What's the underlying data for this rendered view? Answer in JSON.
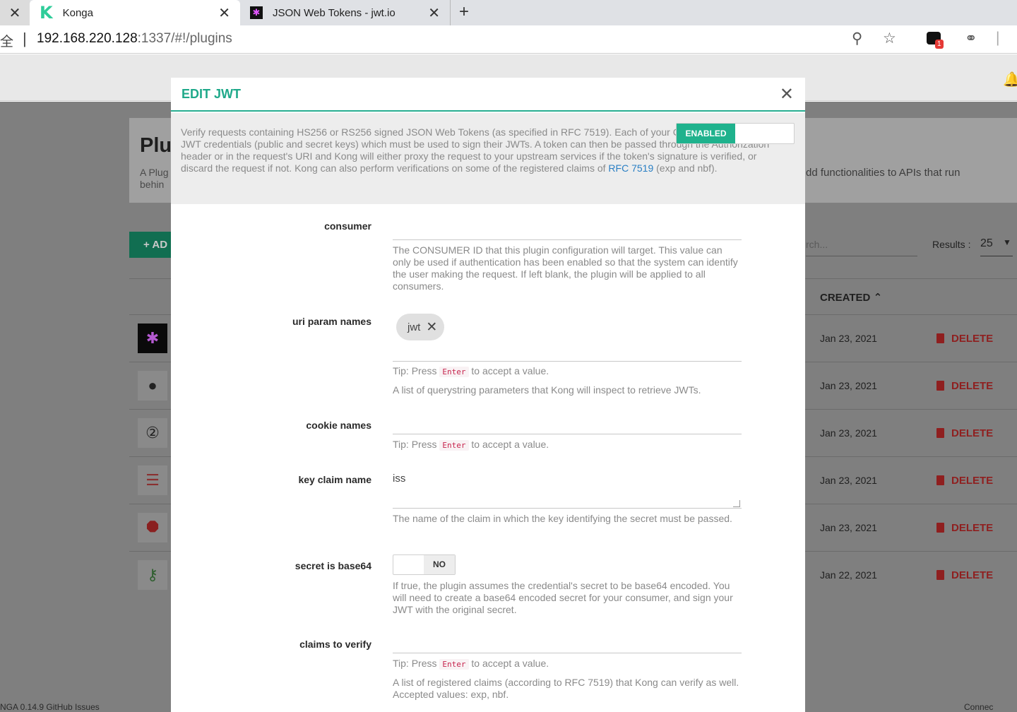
{
  "browser": {
    "tabs": [
      {
        "title": "Konga",
        "favicon": "konga-logo-icon"
      },
      {
        "title": "JSON Web Tokens - jwt.io",
        "favicon": "jwt-icon"
      }
    ],
    "close_glyph": "✕",
    "new_tab_glyph": "+",
    "address_lead": "全",
    "url_host": "192.168.220.128",
    "url_path": ":1337/#!/plugins",
    "extension_badge": "1"
  },
  "background_page": {
    "section_title": "Plu",
    "section_desc_lines": [
      "A Plug",
      "behin"
    ],
    "section_desc_right": "dd functionalities to APIs that run",
    "add_button": "+ AD",
    "search_placeholder": "rch...",
    "results_label": "Results :",
    "results_value": "25",
    "created_header": "CREATED",
    "delete_label": "DELETE",
    "rows": [
      {
        "date": "Jan 23, 2021",
        "icon": "jwt-plugin-icon"
      },
      {
        "date": "Jan 23, 2021",
        "icon": "dots-plugin-icon"
      },
      {
        "date": "Jan 23, 2021",
        "icon": "oauth2-plugin-icon"
      },
      {
        "date": "Jan 23, 2021",
        "icon": "server-plugin-icon"
      },
      {
        "date": "Jan 23, 2021",
        "icon": "stop-plugin-icon"
      },
      {
        "date": "Jan 22, 2021",
        "icon": "key-plugin-icon"
      }
    ],
    "footer_left": "NGA 0.14.9    GitHub    Issues",
    "footer_right": "Connec"
  },
  "modal": {
    "title": "EDIT JWT",
    "close_glyph": "✕",
    "description": "Verify requests containing HS256 or RS256 signed JSON Web Tokens (as specified in RFC 7519). Each of your Consumers will have JWT credentials (public and secret keys) which must be used to sign their JWTs. A token can then be passed through the Authorization header or in the request's URI and Kong will either proxy the request to your upstream services if the token's signature is verified, or discard the request if not. Kong can also perform verifications on some of the registered claims of",
    "description_link": "RFC 7519",
    "description_tail": "(exp and nbf).",
    "enabled_label": "ENABLED",
    "tip_prefix": "Tip: Press",
    "tip_key": "Enter",
    "tip_suffix": "to accept a value.",
    "fields": {
      "consumer": {
        "label": "consumer",
        "value": "",
        "help": "The CONSUMER ID that this plugin configuration will target. This value can only be used if authentication has been enabled so that the system can identify the user making the request. If left blank, the plugin will be applied to all consumers."
      },
      "uri_param_names": {
        "label": "uri param names",
        "chip": "jwt",
        "help": "A list of querystring parameters that Kong will inspect to retrieve JWTs."
      },
      "cookie_names": {
        "label": "cookie names"
      },
      "key_claim_name": {
        "label": "key claim name",
        "value": "iss",
        "help": "The name of the claim in which the key identifying the secret must be passed."
      },
      "secret_is_base64": {
        "label": "secret is base64",
        "toggle": "NO",
        "help": "If true, the plugin assumes the credential's secret to be base64 encoded. You will need to create a base64 encoded secret for your consumer, and sign your JWT with the original secret."
      },
      "claims_to_verify": {
        "label": "claims to verify",
        "help": "A list of registered claims (according to RFC 7519) that Kong can verify as well. Accepted values: exp, nbf."
      }
    }
  }
}
